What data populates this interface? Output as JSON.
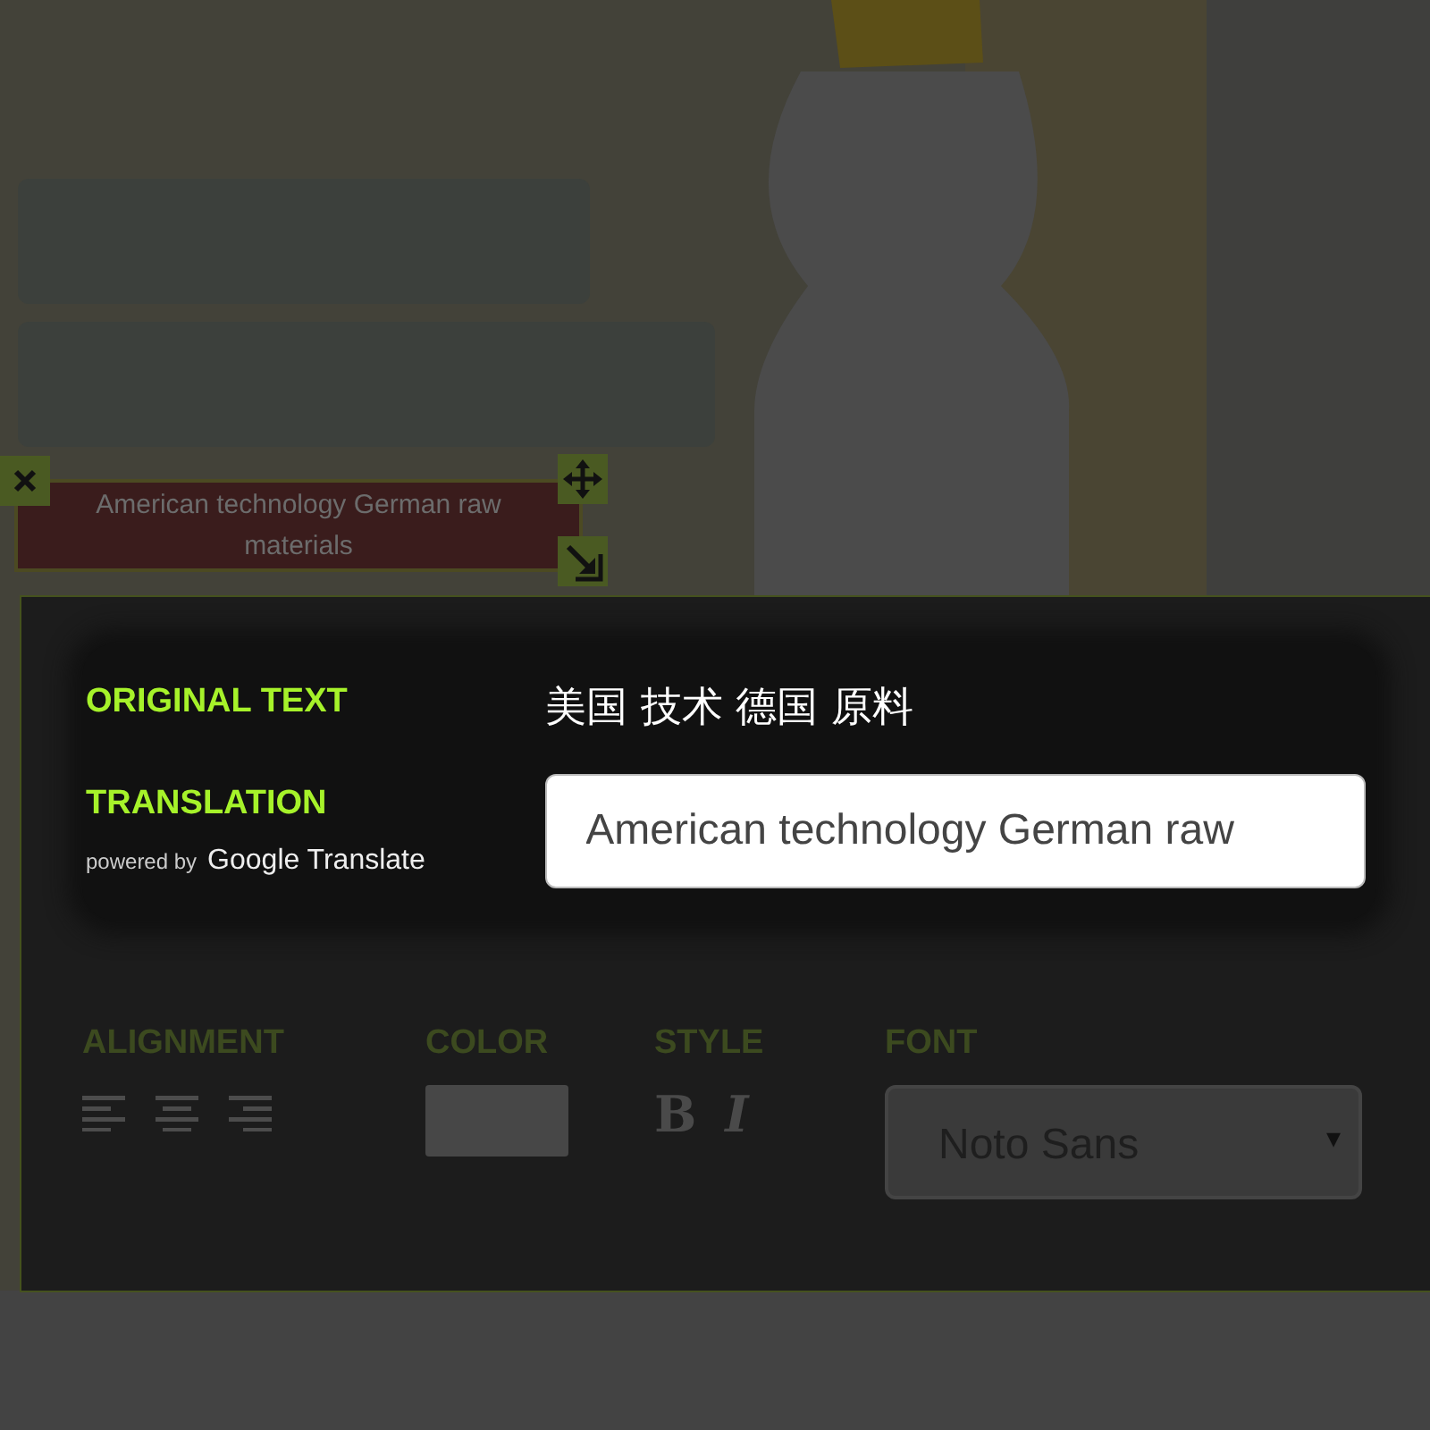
{
  "text_box": {
    "text": "American technology German raw materials"
  },
  "translation_panel": {
    "original_label": "ORIGINAL TEXT",
    "original_text": "美国 技术 德国 原料",
    "translation_label": "TRANSLATION",
    "powered_by": "powered by",
    "provider": "Google Translate",
    "translation_value": "American technology German raw"
  },
  "controls": {
    "disabled": true,
    "alignment_label": "ALIGNMENT",
    "alignments": [
      {
        "kind": "left",
        "selected": false
      },
      {
        "kind": "center",
        "selected": false
      },
      {
        "kind": "right",
        "selected": false
      }
    ],
    "color_label": "COLOR",
    "color": "#474747",
    "style_label": "STYLE",
    "bold": "B",
    "italic": "I",
    "font_label": "FONT",
    "font": "Noto Sans",
    "font_caret": "▾"
  }
}
